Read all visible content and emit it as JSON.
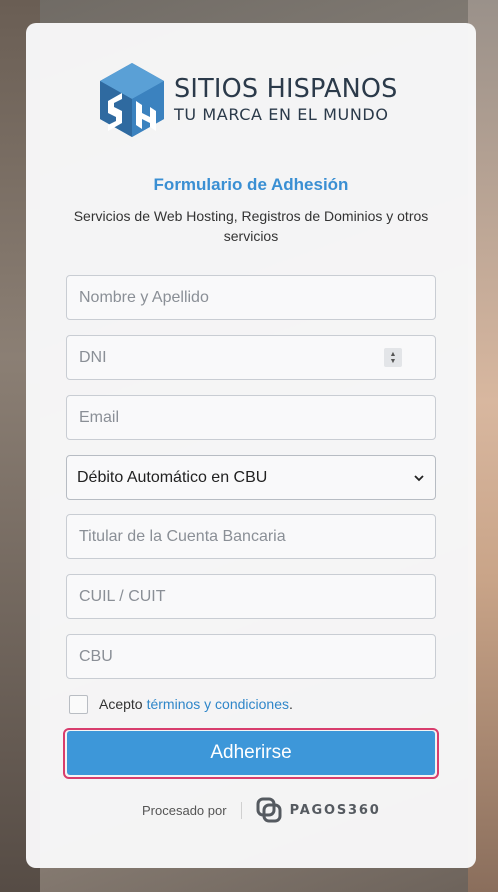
{
  "brand": {
    "name": "SITIOS HISPANOS",
    "tagline": "TU MARCA EN EL MUNDO",
    "colors": {
      "dark": "#2b3a4a",
      "primary": "#3d97d9",
      "focus": "#d83d6d"
    }
  },
  "form": {
    "title": "Formulario de Adhesión",
    "subtitle": "Servicios de Web Hosting, Registros de Dominios y otros servicios",
    "fields": {
      "name_placeholder": "Nombre y Apellido",
      "dni_placeholder": "DNI",
      "email_placeholder": "Email",
      "payment_method": "Débito Automático en CBU",
      "holder_placeholder": "Titular de la Cuenta Bancaria",
      "cuil_placeholder": "CUIL / CUIT",
      "cbu_placeholder": "CBU"
    },
    "terms": {
      "prefix": "Acepto",
      "link": "términos y condiciones",
      "suffix": ".",
      "checked": false
    },
    "submit_label": "Adherirse"
  },
  "footer": {
    "processed_by": "Procesado por",
    "provider": "PAGOS360"
  }
}
